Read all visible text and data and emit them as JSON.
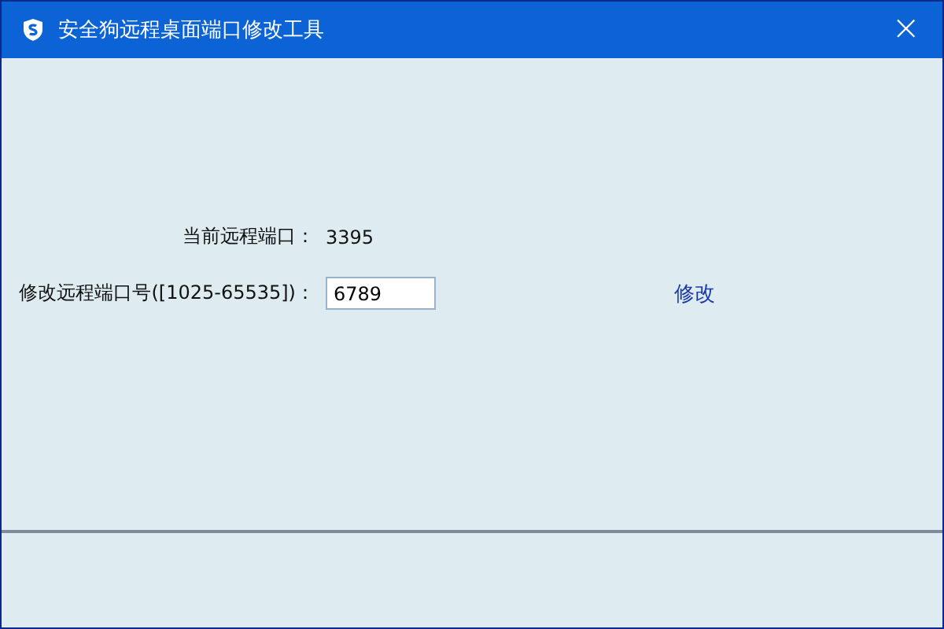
{
  "window": {
    "title": "安全狗远程桌面端口修改工具",
    "close": "×"
  },
  "current_port": {
    "label": "当前远程端口：",
    "value": "3395"
  },
  "change_port": {
    "label": "修改远程端口号([1025-65535])：",
    "value": "6789",
    "action": "修改"
  }
}
